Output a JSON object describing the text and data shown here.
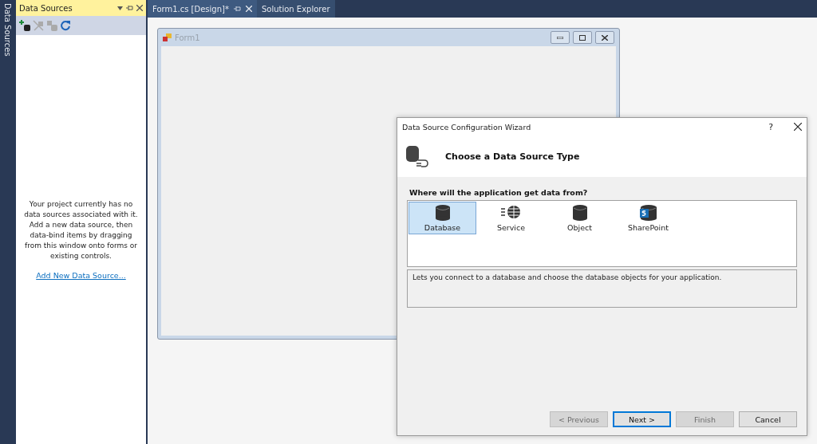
{
  "side_tab": {
    "label": "Data Sources"
  },
  "data_sources_panel": {
    "title": "Data Sources",
    "toolbar": [
      {
        "kind": "add",
        "disabled": false
      },
      {
        "kind": "edit",
        "disabled": true
      },
      {
        "kind": "configure",
        "disabled": true
      },
      {
        "kind": "refresh",
        "disabled": false
      }
    ],
    "message": "Your project currently has no data sources associated with it. Add a new data source, then data-bind items by dragging from this window onto forms or existing controls.",
    "link": "Add New Data Source..."
  },
  "document_tabs": [
    {
      "label": "Form1.cs [Design]*",
      "selected": true
    },
    {
      "label": "Solution Explorer",
      "selected": false
    }
  ],
  "form": {
    "title": "Form1"
  },
  "wizard": {
    "title": "Data Source Configuration Wizard",
    "help": "?",
    "heading": "Choose a Data Source Type",
    "question": "Where will the application get data from?",
    "source_types": [
      {
        "label": "Database",
        "kind": "database",
        "selected": true
      },
      {
        "label": "Service",
        "kind": "service",
        "selected": false
      },
      {
        "label": "Object",
        "kind": "object",
        "selected": false
      },
      {
        "label": "SharePoint",
        "kind": "sharepoint",
        "selected": false
      }
    ],
    "description": "Lets you connect to a database and choose the database objects for your application.",
    "buttons": [
      {
        "label": "< Previous",
        "disabled": true,
        "default": false
      },
      {
        "label": "Next >",
        "disabled": false,
        "default": true
      },
      {
        "label": "Finish",
        "disabled": true,
        "default": false
      },
      {
        "label": "Cancel",
        "disabled": false,
        "default": false
      }
    ]
  }
}
